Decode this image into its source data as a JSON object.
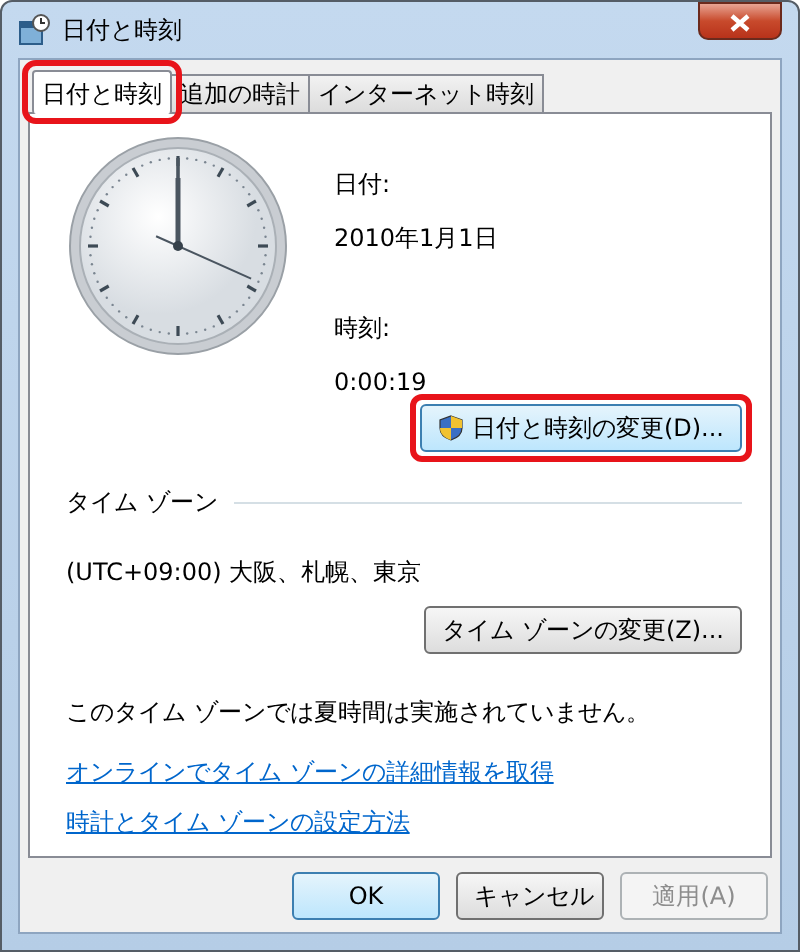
{
  "window": {
    "title": "日付と時刻"
  },
  "tabs": [
    {
      "label": "日付と時刻",
      "selected": true,
      "highlighted": true
    },
    {
      "label": "追加の時計",
      "selected": false,
      "highlighted": false
    },
    {
      "label": "インターネット時刻",
      "selected": false,
      "highlighted": false
    }
  ],
  "date": {
    "label": "日付:",
    "value": "2010年1月1日"
  },
  "time": {
    "label": "時刻:",
    "value": "0:00:19"
  },
  "change_datetime_button": {
    "label": "日付と時刻の変更(D)...",
    "highlighted": true
  },
  "timezone": {
    "heading": "タイム ゾーン",
    "value": "(UTC+09:00) 大阪、札幌、東京",
    "button": "タイム ゾーンの変更(Z)...",
    "dst_note": "このタイム ゾーンでは夏時間は実施されていません。"
  },
  "links": [
    "オンラインでタイム ゾーンの詳細情報を取得",
    "時計とタイム ゾーンの設定方法"
  ],
  "buttons": [
    {
      "label": "OK",
      "disabled": false,
      "default": true
    },
    {
      "label": "キャンセル",
      "disabled": false,
      "default": false
    },
    {
      "label": "適用(A)",
      "disabled": true,
      "default": false
    }
  ]
}
